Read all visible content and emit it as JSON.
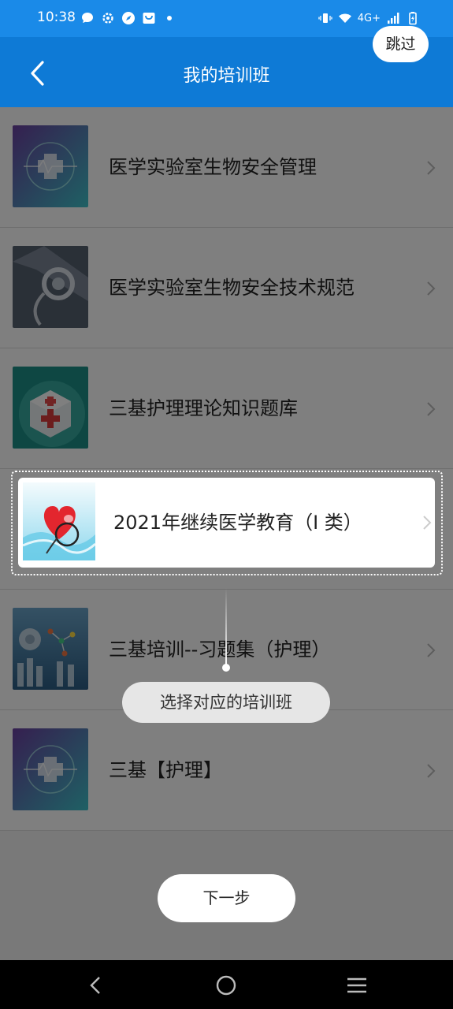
{
  "status_bar": {
    "time": "10:38",
    "network": "4G+",
    "left_icons": [
      "chat-icon",
      "settings-icon",
      "compass-icon",
      "bag-icon",
      "dot-icon"
    ],
    "right_icons": [
      "vibrate-icon",
      "wifi-icon",
      "signal-icon",
      "battery-charging-icon"
    ]
  },
  "header": {
    "title": "我的培训班",
    "skip_label": "跳过"
  },
  "courses": [
    {
      "label": "医学实验室生物安全管理",
      "thumb": "medical-cross"
    },
    {
      "label": "医学实验室生物安全技术规范",
      "thumb": "stethoscope"
    },
    {
      "label": "三基护理理论知识题库",
      "thumb": "first-aid-cube"
    },
    {
      "label": "2021年继续医学教育（I 类）",
      "thumb": "heart-stethoscope"
    },
    {
      "label": "三基培训--习题集（护理）",
      "thumb": "lab-molecules"
    },
    {
      "label": "三基【护理】",
      "thumb": "medical-cross"
    }
  ],
  "guide": {
    "tip_text": "选择对应的培训班",
    "highlighted_index": 3
  },
  "next_button": "下一步",
  "colors": {
    "status_bar": "#1a8ae8",
    "app_bar": "#0e7ad6",
    "overlay": "rgba(0,0,0,0.5)"
  }
}
